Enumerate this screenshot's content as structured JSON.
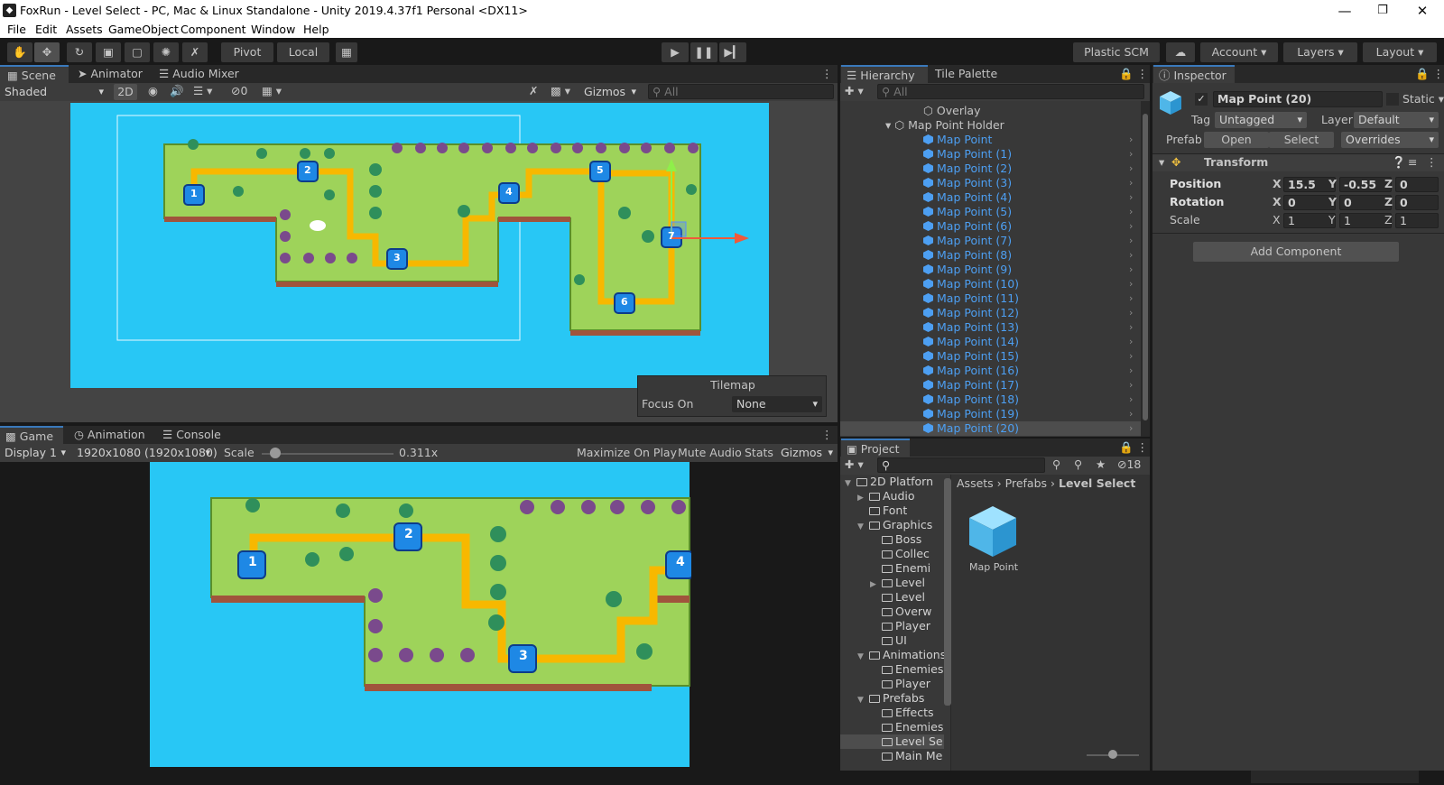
{
  "window": {
    "title": "FoxRun - Level Select - PC, Mac & Linux Standalone - Unity 2019.4.37f1 Personal <DX11>"
  },
  "menu": [
    "File",
    "Edit",
    "Assets",
    "GameObject",
    "Component",
    "Window",
    "Help"
  ],
  "toolbar": {
    "pivot": "Pivot",
    "local": "Local",
    "plastic": "Plastic SCM",
    "account": "Account",
    "layers": "Layers",
    "layout": "Layout"
  },
  "scene_tabs": [
    "Scene",
    "Animator",
    "Audio Mixer"
  ],
  "scene_bar": {
    "shading": "Shaded",
    "mode2d": "2D",
    "hidden_count": "0",
    "gizmos": "Gizmos",
    "search_placeholder": "All"
  },
  "tilemap_overlay": {
    "title": "Tilemap",
    "focus_label": "Focus On",
    "focus_value": "None"
  },
  "game_tabs": [
    "Game",
    "Animation",
    "Console"
  ],
  "game_bar": {
    "display": "Display 1",
    "resolution": "1920x1080 (1920x1080)",
    "scale_label": "Scale",
    "scale_value": "0.311x",
    "scale_fraction": 0.1,
    "maximize": "Maximize On Play",
    "mute": "Mute Audio",
    "stats": "Stats",
    "gizmos": "Gizmos"
  },
  "hierarchy": {
    "tabs": [
      "Hierarchy",
      "Tile Palette"
    ],
    "search_placeholder": "All",
    "overlay": "Overlay",
    "holder": "Map Point Holder",
    "items": [
      "Map Point",
      "Map Point (1)",
      "Map Point (2)",
      "Map Point (3)",
      "Map Point (4)",
      "Map Point (5)",
      "Map Point (6)",
      "Map Point (7)",
      "Map Point (8)",
      "Map Point (9)",
      "Map Point (10)",
      "Map Point (11)",
      "Map Point (12)",
      "Map Point (13)",
      "Map Point (14)",
      "Map Point (15)",
      "Map Point (16)",
      "Map Point (17)",
      "Map Point (18)",
      "Map Point (19)",
      "Map Point (20)"
    ],
    "selected": "Map Point (20)"
  },
  "inspector": {
    "tab": "Inspector",
    "object_name": "Map Point (20)",
    "static_label": "Static",
    "tag_label": "Tag",
    "tag_value": "Untagged",
    "layer_label": "Layer",
    "layer_value": "Default",
    "prefab_label": "Prefab",
    "open": "Open",
    "select": "Select",
    "overrides": "Overrides",
    "transform_title": "Transform",
    "position_label": "Position",
    "rotation_label": "Rotation",
    "scale_label": "Scale",
    "position": {
      "x": "15.5",
      "y": "-0.55",
      "z": "0"
    },
    "rotation": {
      "x": "0",
      "y": "0",
      "z": "0"
    },
    "scale": {
      "x": "1",
      "y": "1",
      "z": "1"
    },
    "add_component": "Add Component"
  },
  "project": {
    "tab": "Project",
    "hidden_count": "18",
    "breadcrumb": [
      "Assets",
      "Prefabs",
      "Level Select"
    ],
    "asset_name": "Map Point",
    "tree": [
      {
        "label": "2D Platforn",
        "depth": 0,
        "arrow": "down"
      },
      {
        "label": "Audio",
        "depth": 1,
        "arrow": "right"
      },
      {
        "label": "Font",
        "depth": 1,
        "arrow": ""
      },
      {
        "label": "Graphics",
        "depth": 1,
        "arrow": "down"
      },
      {
        "label": "Boss",
        "depth": 2,
        "arrow": ""
      },
      {
        "label": "Collec",
        "depth": 2,
        "arrow": ""
      },
      {
        "label": "Enemi",
        "depth": 2,
        "arrow": ""
      },
      {
        "label": "Level",
        "depth": 2,
        "arrow": "right"
      },
      {
        "label": "Level",
        "depth": 2,
        "arrow": ""
      },
      {
        "label": "Overw",
        "depth": 2,
        "arrow": ""
      },
      {
        "label": "Player",
        "depth": 2,
        "arrow": ""
      },
      {
        "label": "UI",
        "depth": 2,
        "arrow": ""
      },
      {
        "label": "Animations",
        "depth": 1,
        "arrow": "down"
      },
      {
        "label": "Enemies",
        "depth": 2,
        "arrow": ""
      },
      {
        "label": "Player",
        "depth": 2,
        "arrow": ""
      },
      {
        "label": "Prefabs",
        "depth": 1,
        "arrow": "down"
      },
      {
        "label": "Effects",
        "depth": 2,
        "arrow": ""
      },
      {
        "label": "Enemies",
        "depth": 2,
        "arrow": ""
      },
      {
        "label": "Level Se",
        "depth": 2,
        "arrow": ""
      },
      {
        "label": "Main Me",
        "depth": 2,
        "arrow": ""
      }
    ]
  },
  "colors": {
    "accent": "#3a79bb",
    "link": "#4d9ff2",
    "water": "#28c7f5",
    "grass": "#9ed35a",
    "path": "#f7b800",
    "marker": "#1e88e5"
  },
  "scene_markers": [
    "1",
    "2",
    "3",
    "4",
    "5",
    "6",
    "7"
  ],
  "game_markers": [
    "1",
    "2",
    "3",
    "4"
  ]
}
